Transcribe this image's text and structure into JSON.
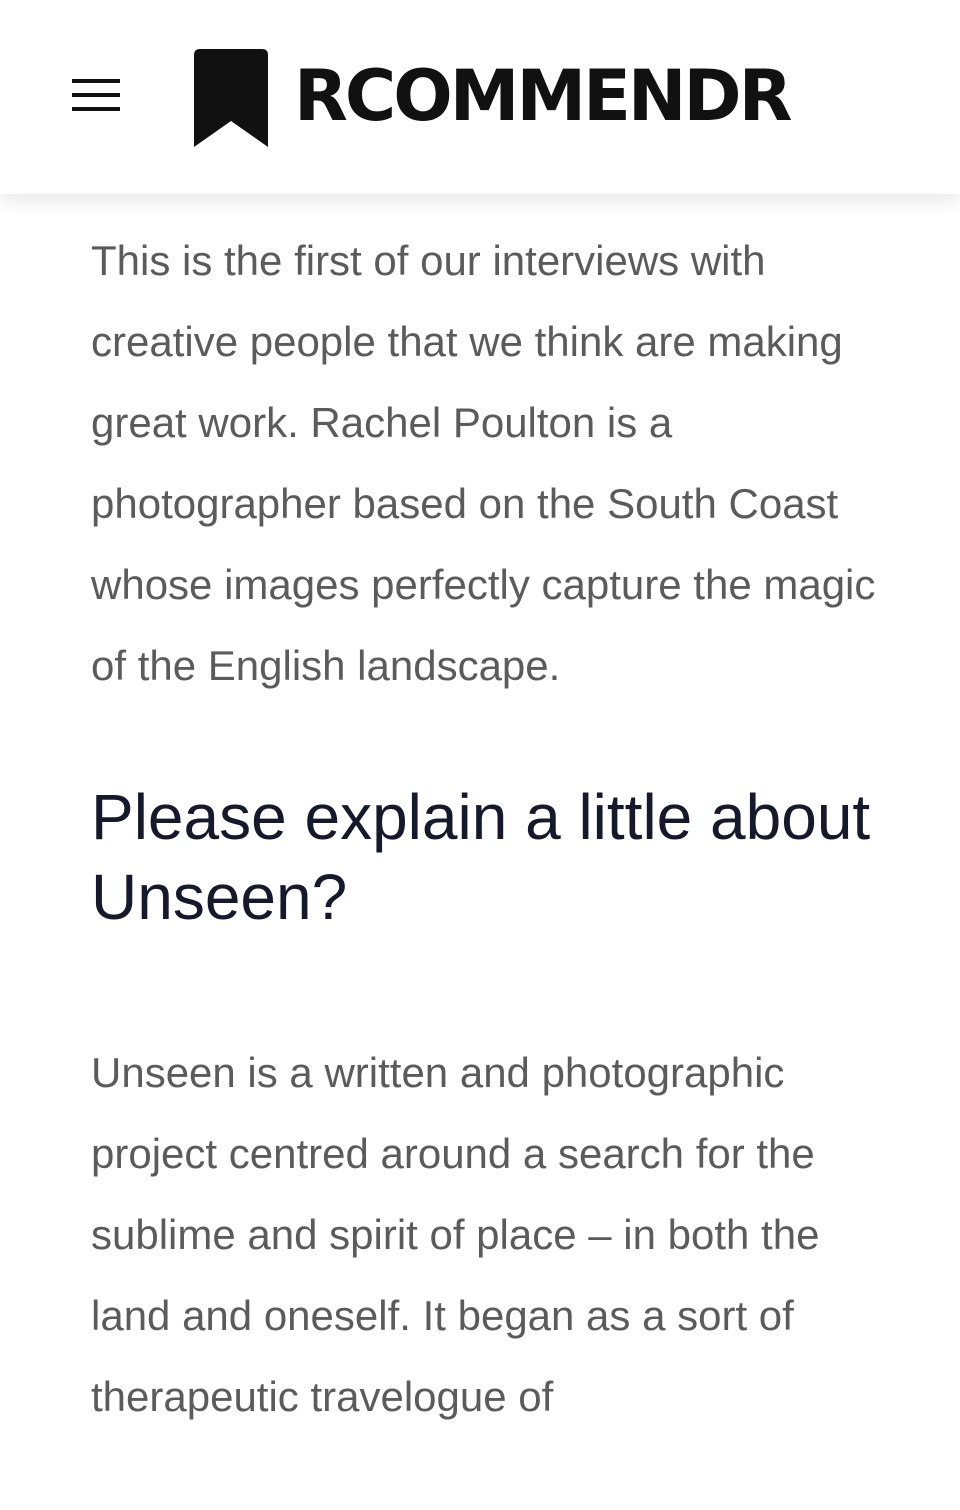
{
  "header": {
    "logo_text": "RCOMMENDR",
    "menu_icon": "hamburger-menu-icon",
    "logo_icon": "bookmark-icon"
  },
  "article": {
    "intro": "This is the first of our interviews with creative people that we think are making great work. Rachel Poulton is a photographer based on the South Coast whose images perfectly capture the magic of the English landscape.",
    "heading": "Please explain a little about Unseen?",
    "answer": "Unseen is a written and photographic project centred around a search for the sublime and spirit of place – in both the land and oneself. It began as a sort of therapeutic travelogue of"
  },
  "colors": {
    "body_text": "#5b5b5b",
    "heading_text": "#15192b",
    "logo": "#111111"
  }
}
